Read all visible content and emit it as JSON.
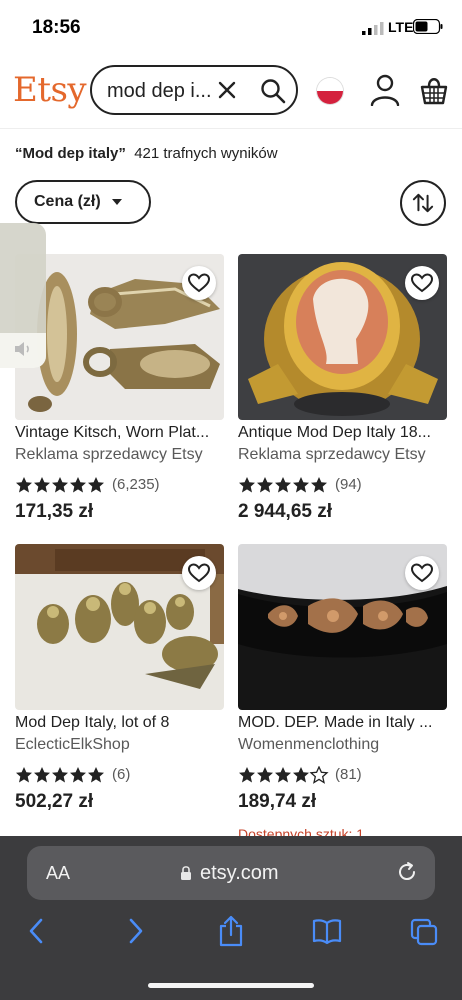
{
  "status": {
    "time": "18:56",
    "network": "LTE"
  },
  "header": {
    "logo": "Etsy",
    "search_query": "mod dep i...",
    "icons": [
      "flag-icon",
      "user-icon",
      "cart-icon"
    ]
  },
  "results": {
    "query_quoted": "“Mod dep italy”",
    "count_text": "421 trafnych wyników"
  },
  "filters": {
    "price_label": "Cena (zł)"
  },
  "products": [
    {
      "title": "Vintage Kitsch, Worn Plat...",
      "shop": "Reklama sprzedawcy Etsy",
      "rating": 5,
      "reviews": "(6,235)",
      "price": "171,35 zł",
      "stock": ""
    },
    {
      "title": "Antique Mod Dep Italy 18...",
      "shop": "Reklama sprzedawcy Etsy",
      "rating": 5,
      "reviews": "(94)",
      "price": "2 944,65 zł",
      "stock": ""
    },
    {
      "title": "Mod Dep Italy, lot of 8",
      "shop": "EclecticElkShop",
      "rating": 5,
      "reviews": "(6)",
      "price": "502,27 zł",
      "stock": ""
    },
    {
      "title": "MOD. DEP. Made in Italy ...",
      "shop": "Womenmenclothing",
      "rating": 4.5,
      "reviews": "(81)",
      "price": "189,74 zł",
      "stock": "Dostępnych sztuk: 1"
    }
  ],
  "browser": {
    "aa_label": "AA",
    "url": "etsy.com"
  },
  "colors": {
    "etsy_orange": "#e4682c",
    "safari_blue": "#4a8cf7",
    "star": "#222222"
  }
}
